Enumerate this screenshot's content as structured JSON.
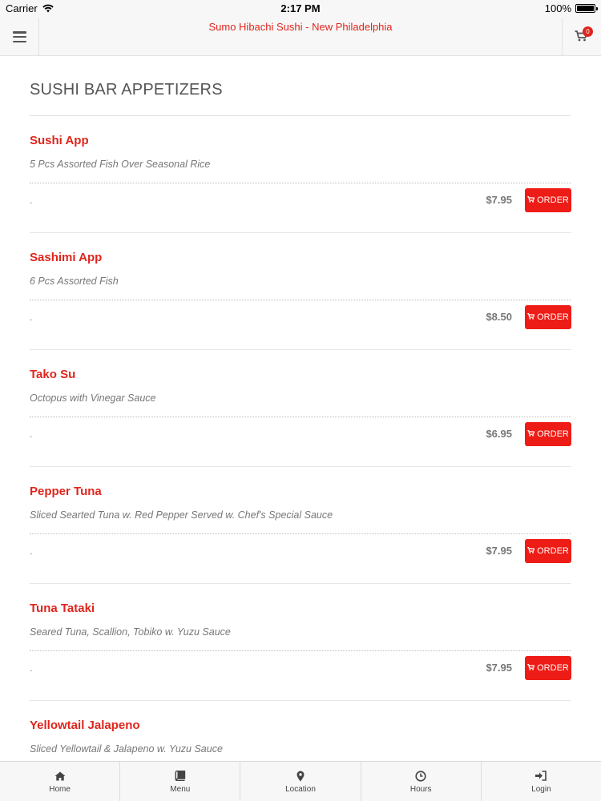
{
  "status": {
    "carrier": "Carrier",
    "time": "2:17 PM",
    "battery": "100%",
    "battery_level": 1.0
  },
  "header": {
    "title": "Sumo Hibachi Sushi - New Philadelphia",
    "cart_count": "0"
  },
  "menu": {
    "section_title": "SUSHI BAR APPETIZERS",
    "order_label": "ORDER",
    "items": [
      {
        "name": "Sushi App",
        "description": "5 Pcs Assorted Fish Over Seasonal Rice",
        "extra": ".",
        "price": "$7.95"
      },
      {
        "name": "Sashimi App",
        "description": "6 Pcs Assorted Fish",
        "extra": ".",
        "price": "$8.50"
      },
      {
        "name": "Tako Su",
        "description": "Octopus with Vinegar Sauce",
        "extra": ".",
        "price": "$6.95"
      },
      {
        "name": "Pepper Tuna",
        "description": "Sliced Searted Tuna w. Red Pepper Served w. Chef's Special Sauce",
        "extra": ".",
        "price": "$7.95"
      },
      {
        "name": "Tuna Tataki",
        "description": "Seared Tuna, Scallion, Tobiko w. Yuzu Sauce",
        "extra": ".",
        "price": "$7.95"
      },
      {
        "name": "Yellowtail Jalapeno",
        "description": "Sliced Yellowtail & Jalapeno w. Yuzu Sauce",
        "extra": "",
        "price": ""
      }
    ]
  },
  "tabbar": {
    "tabs": [
      {
        "label": "Home",
        "icon": "home-icon"
      },
      {
        "label": "Menu",
        "icon": "book-icon"
      },
      {
        "label": "Location",
        "icon": "map-marker-icon"
      },
      {
        "label": "Hours",
        "icon": "clock-icon"
      },
      {
        "label": "Login",
        "icon": "sign-in-icon"
      }
    ]
  },
  "colors": {
    "accent": "#e0251c",
    "order_button": "#ee1c16",
    "bar_background": "#f7f7f7"
  }
}
